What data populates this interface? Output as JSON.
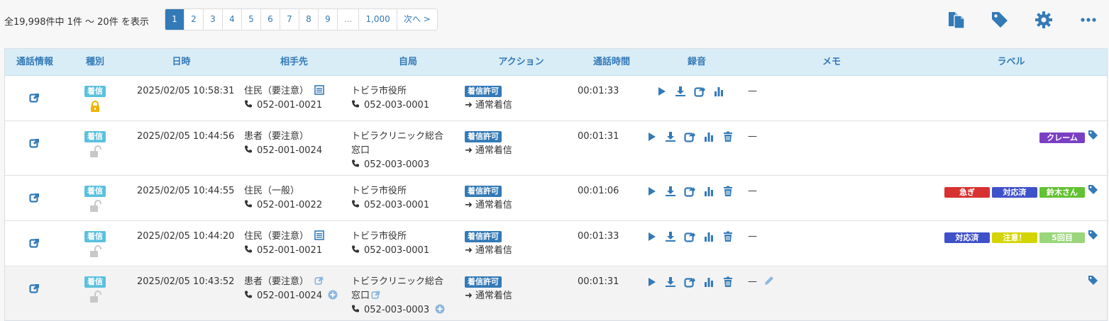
{
  "summary": "全19,998件中 1件 〜 20件 を表示",
  "pagination": [
    {
      "label": "1",
      "active": true
    },
    {
      "label": "2"
    },
    {
      "label": "3"
    },
    {
      "label": "4"
    },
    {
      "label": "5"
    },
    {
      "label": "6"
    },
    {
      "label": "7"
    },
    {
      "label": "8"
    },
    {
      "label": "9"
    },
    {
      "label": "...",
      "disabled": true
    },
    {
      "label": "1,000"
    },
    {
      "label": "次へ >"
    }
  ],
  "toolbar": {
    "icons": [
      "copy-icon",
      "tag-icon",
      "gear-icon",
      "more-icon"
    ]
  },
  "colors": {
    "accent": "#337ab7",
    "header_bg": "#d9edf7",
    "badge_in": "#5bc0de",
    "lock_gold": "#f0b400"
  },
  "columns": [
    "通話情報",
    "種別",
    "日時",
    "相手先",
    "自局",
    "アクション",
    "通話時間",
    "録音",
    "メモ",
    "ラベル"
  ],
  "rows": [
    {
      "type": "着信",
      "locked": true,
      "datetime": "2025/02/05 10:58:31",
      "party_name": "住民（要注意）",
      "party_icon": "list-icon",
      "party_tel": "052-001-0021",
      "station_lines": [
        "トビラ市役所"
      ],
      "station_tel": "052-003-0001",
      "action_badge": "着信許可",
      "action_text": "通常着信",
      "duration": "00:01:33",
      "recording_delete": false,
      "memo": "—",
      "labels": [],
      "label_tag": false
    },
    {
      "type": "着信",
      "locked": false,
      "datetime": "2025/02/05 10:44:56",
      "party_name": "患者（要注意）",
      "party_icon": "",
      "party_tel": "052-001-0024",
      "station_lines": [
        "トビラクリニック総合",
        "窓口"
      ],
      "station_tel": "052-003-0003",
      "action_badge": "着信許可",
      "action_text": "通常着信",
      "duration": "00:01:31",
      "recording_delete": true,
      "memo": "—",
      "labels": [
        {
          "text": "クレーム",
          "color": "#7b3fc4"
        }
      ],
      "label_tag": true
    },
    {
      "type": "着信",
      "locked": false,
      "datetime": "2025/02/05 10:44:55",
      "party_name": "住民（一般）",
      "party_icon": "",
      "party_tel": "052-001-0022",
      "station_lines": [
        "トビラ市役所"
      ],
      "station_tel": "052-003-0001",
      "action_badge": "着信許可",
      "action_text": "通常着信",
      "duration": "00:01:06",
      "recording_delete": true,
      "memo": "—",
      "labels": [
        {
          "text": "急ぎ",
          "color": "#d63232"
        },
        {
          "text": "対応済",
          "color": "#3f51c9"
        },
        {
          "text": "鈴木さん",
          "color": "#63c132"
        }
      ],
      "label_tag": true
    },
    {
      "type": "着信",
      "locked": false,
      "datetime": "2025/02/05 10:44:20",
      "party_name": "住民（要注意）",
      "party_icon": "list-icon",
      "party_tel": "052-001-0021",
      "station_lines": [
        "トビラ市役所"
      ],
      "station_tel": "052-003-0001",
      "action_badge": "着信許可",
      "action_text": "通常着信",
      "duration": "00:01:33",
      "recording_delete": true,
      "memo": "—",
      "labels": [
        {
          "text": "対応済",
          "color": "#3f51c9"
        },
        {
          "text": "注意！",
          "color": "#d4d400"
        },
        {
          "text": "5回目",
          "color": "#9ad67a"
        }
      ],
      "label_tag": true
    },
    {
      "type": "着信",
      "locked": false,
      "highlight": true,
      "datetime": "2025/02/05 10:43:52",
      "party_name": "患者（要注意）",
      "party_icon": "external-link-icon",
      "party_tel": "052-001-0024",
      "party_tel_add": true,
      "station_lines": [
        "トビラクリニック総合",
        "窓口"
      ],
      "station_link": true,
      "station_tel": "052-003-0003",
      "station_tel_add": true,
      "action_badge": "着信許可",
      "action_text": "通常着信",
      "duration": "00:01:31",
      "recording_delete": true,
      "memo": "—",
      "memo_edit": true,
      "labels": [],
      "label_tag": true
    }
  ]
}
